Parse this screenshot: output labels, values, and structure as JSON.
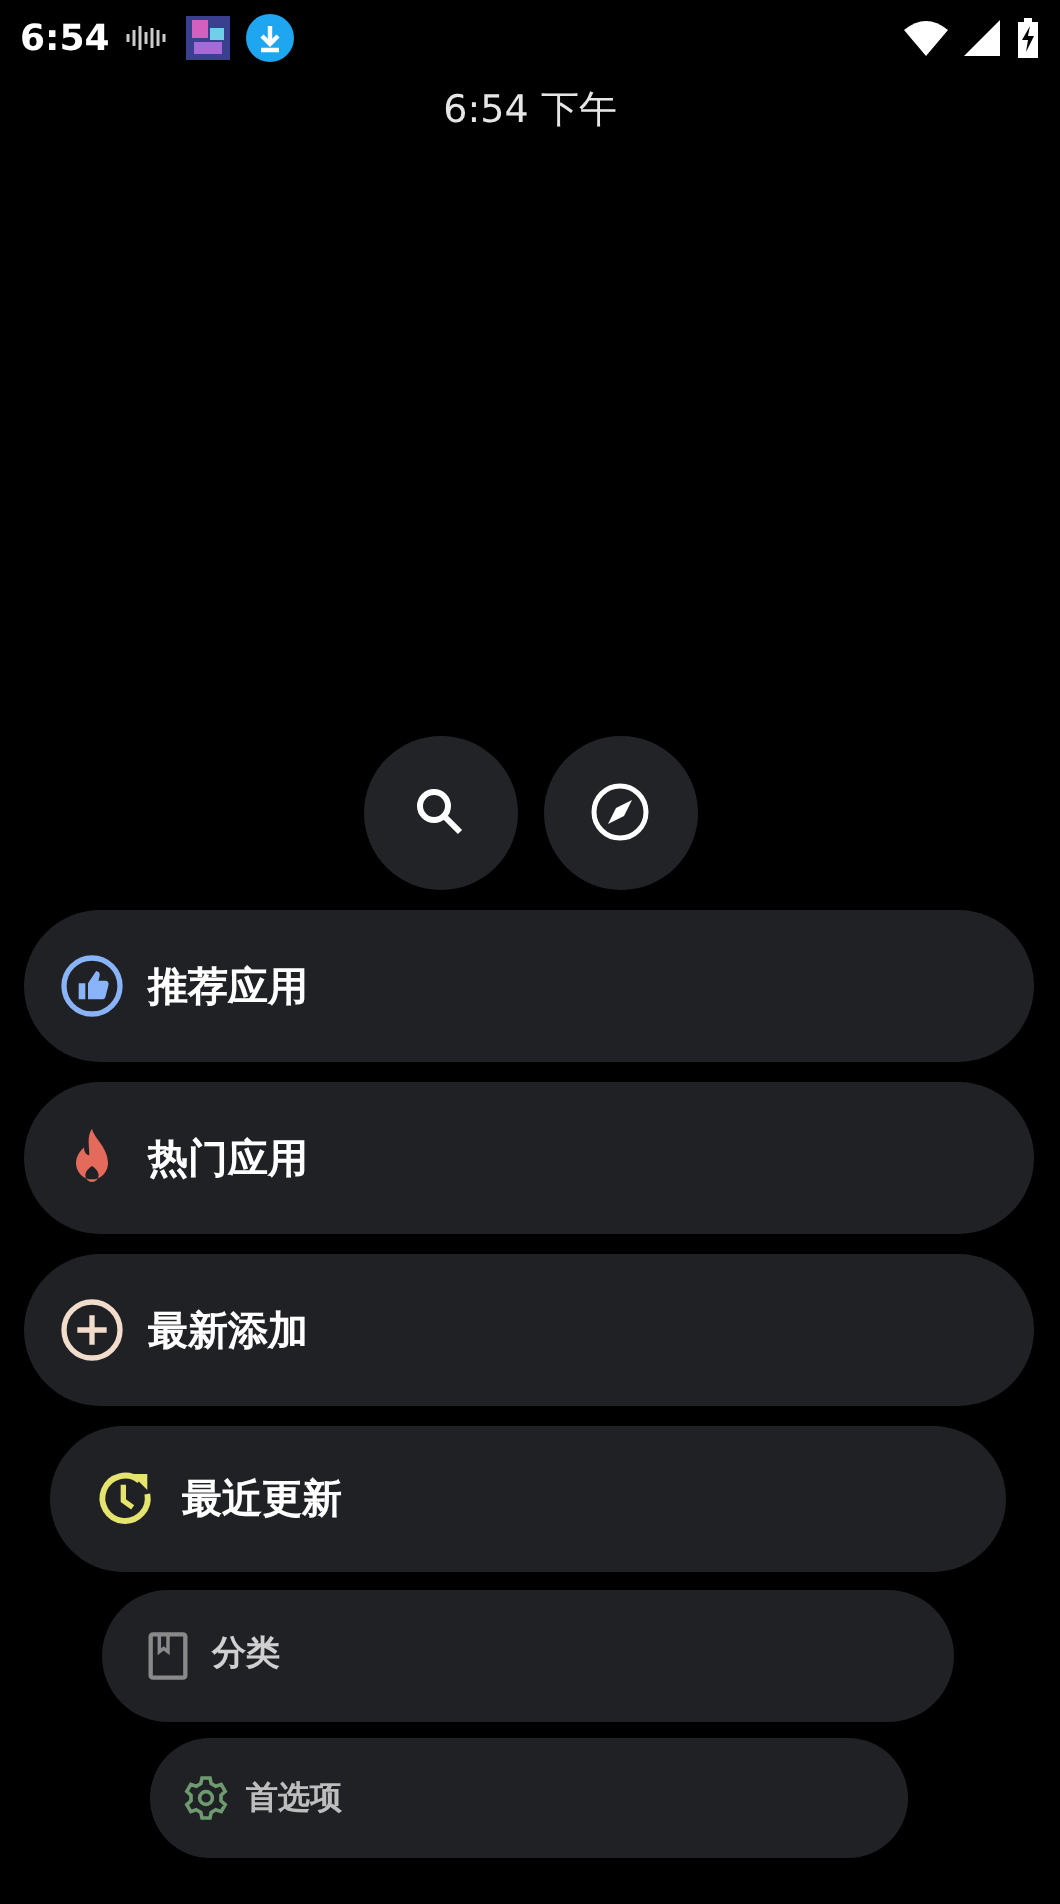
{
  "status_bar": {
    "time": "6:54"
  },
  "clock": "6:54 下午",
  "round_buttons": [
    {
      "kind": "search"
    },
    {
      "kind": "explore"
    }
  ],
  "menu": [
    {
      "label": "推荐应用",
      "kind": "thumb",
      "color": "#8ab4f8"
    },
    {
      "label": "热门应用",
      "kind": "flame",
      "color": "#e46a5c"
    },
    {
      "label": "最新添加",
      "kind": "plus",
      "color": "#f2dccb"
    },
    {
      "label": "最近更新",
      "kind": "history",
      "color": "#e4e46e"
    },
    {
      "label": "分类",
      "kind": "book",
      "color": "#8a8a8a"
    },
    {
      "label": "首选项",
      "kind": "gear",
      "color": "#6f9a70"
    }
  ]
}
